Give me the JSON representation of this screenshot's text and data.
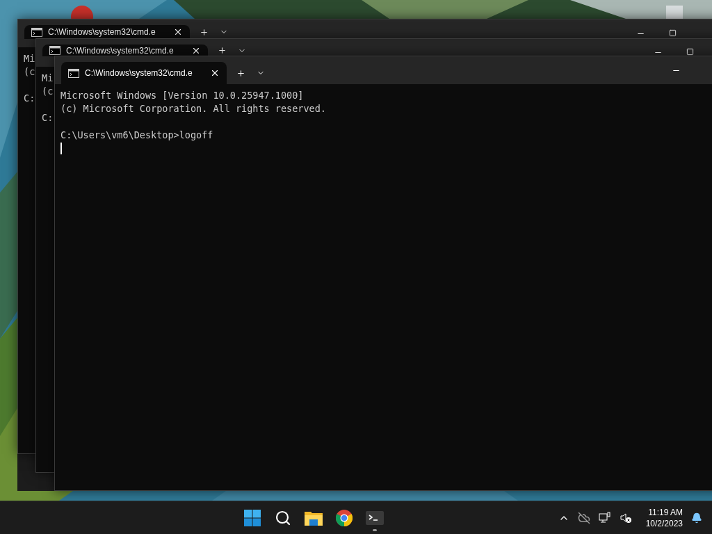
{
  "windows": [
    {
      "tab_title": "C:\\Windows\\system32\\cmd.e",
      "paragraphs": [
        [
          "Mi",
          "(c"
        ],
        [
          "C:"
        ]
      ],
      "controls": [
        {
          "kind": "minimize"
        },
        {
          "kind": "maximize"
        }
      ],
      "cursor": false
    },
    {
      "tab_title": "C:\\Windows\\system32\\cmd.e",
      "paragraphs": [
        [
          "Mi",
          "(c"
        ],
        [
          "C:"
        ]
      ],
      "controls": [
        {
          "kind": "minimize"
        },
        {
          "kind": "maximize"
        }
      ],
      "cursor": false
    },
    {
      "tab_title": "C:\\Windows\\system32\\cmd.e",
      "paragraphs": [
        [
          "Microsoft Windows [Version 10.0.25947.1000]",
          "(c) Microsoft Corporation. All rights reserved."
        ],
        [
          "C:\\Users\\vm6\\Desktop>logoff"
        ]
      ],
      "controls": [
        {
          "kind": "minimize"
        }
      ],
      "cursor": true
    }
  ],
  "taskbar": {
    "apps": [
      {
        "kind": "start",
        "running": false
      },
      {
        "kind": "search",
        "running": false
      },
      {
        "kind": "explorer",
        "running": false
      },
      {
        "kind": "chrome",
        "running": false
      },
      {
        "kind": "terminal",
        "running": true
      }
    ],
    "tray": {
      "time": "11:19 AM",
      "date": "10/2/2023"
    }
  }
}
